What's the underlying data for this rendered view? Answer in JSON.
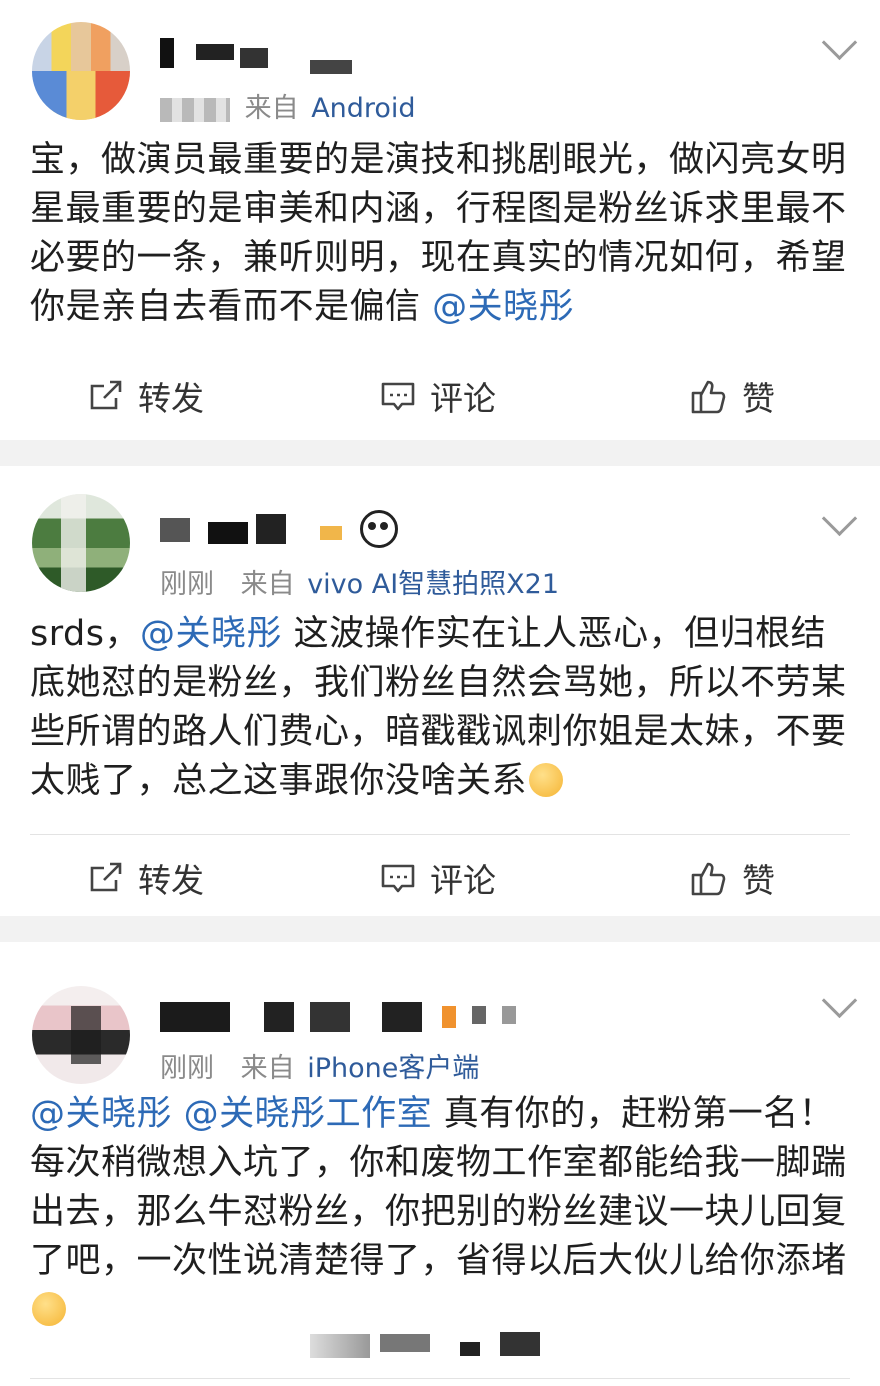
{
  "posts": [
    {
      "author": "",
      "meta_prefix": "来自",
      "source": "Android",
      "content": [
        {
          "text": "宝，做演员最重要的是演技和挑剧眼光，做闪亮女明星最重要的是审美和内涵，行程图是粉丝诉求里最不必要的一条，兼听则明，现在真实的情况如何，希望你是亲自去看而不是偏信 ",
          "type": "text"
        },
        {
          "text": "@关晓彤",
          "type": "mention"
        }
      ],
      "actions": {
        "repost": "转发",
        "comment": "评论",
        "like": "赞"
      }
    },
    {
      "author": "",
      "time": "刚刚",
      "meta_prefix": "来自",
      "source": "vivo AI智慧拍照X21",
      "content": [
        {
          "text": "srds，",
          "type": "text"
        },
        {
          "text": "@关晓彤",
          "type": "mention"
        },
        {
          "text": " 这波操作实在让人恶心，但归根结底她怼的是粉丝，我们粉丝自然会骂她，所以不劳某些所谓的路人们费心，暗戳戳讽刺你姐是太妹，不要太贱了，总之这事跟你没啥关系",
          "type": "text"
        }
      ],
      "actions": {
        "repost": "转发",
        "comment": "评论",
        "like": "赞"
      }
    },
    {
      "author": "",
      "time": "刚刚",
      "meta_prefix": "来自",
      "source": "iPhone客户端",
      "content": [
        {
          "text": "@关晓彤",
          "type": "mention"
        },
        {
          "text": " ",
          "type": "text"
        },
        {
          "text": "@关晓彤工作室",
          "type": "mention"
        },
        {
          "text": "  真有你的，赶粉第一名！每次稍微想入坑了，你和废物工作室都能给我一脚踹出去，那么牛怼粉丝，你把别的粉丝建议一块儿回复了吧，一次性说清楚得了，省得以后大伙儿给你添堵",
          "type": "text"
        }
      ]
    }
  ],
  "icons": {
    "repost": "repost-icon",
    "comment": "comment-icon",
    "like": "thumbs-up-icon",
    "more": "chevron-down-icon"
  },
  "colors": {
    "mention": "#2d6ab6",
    "background": "#f2f2f2",
    "card": "#ffffff",
    "meta": "#8a8a8a"
  }
}
